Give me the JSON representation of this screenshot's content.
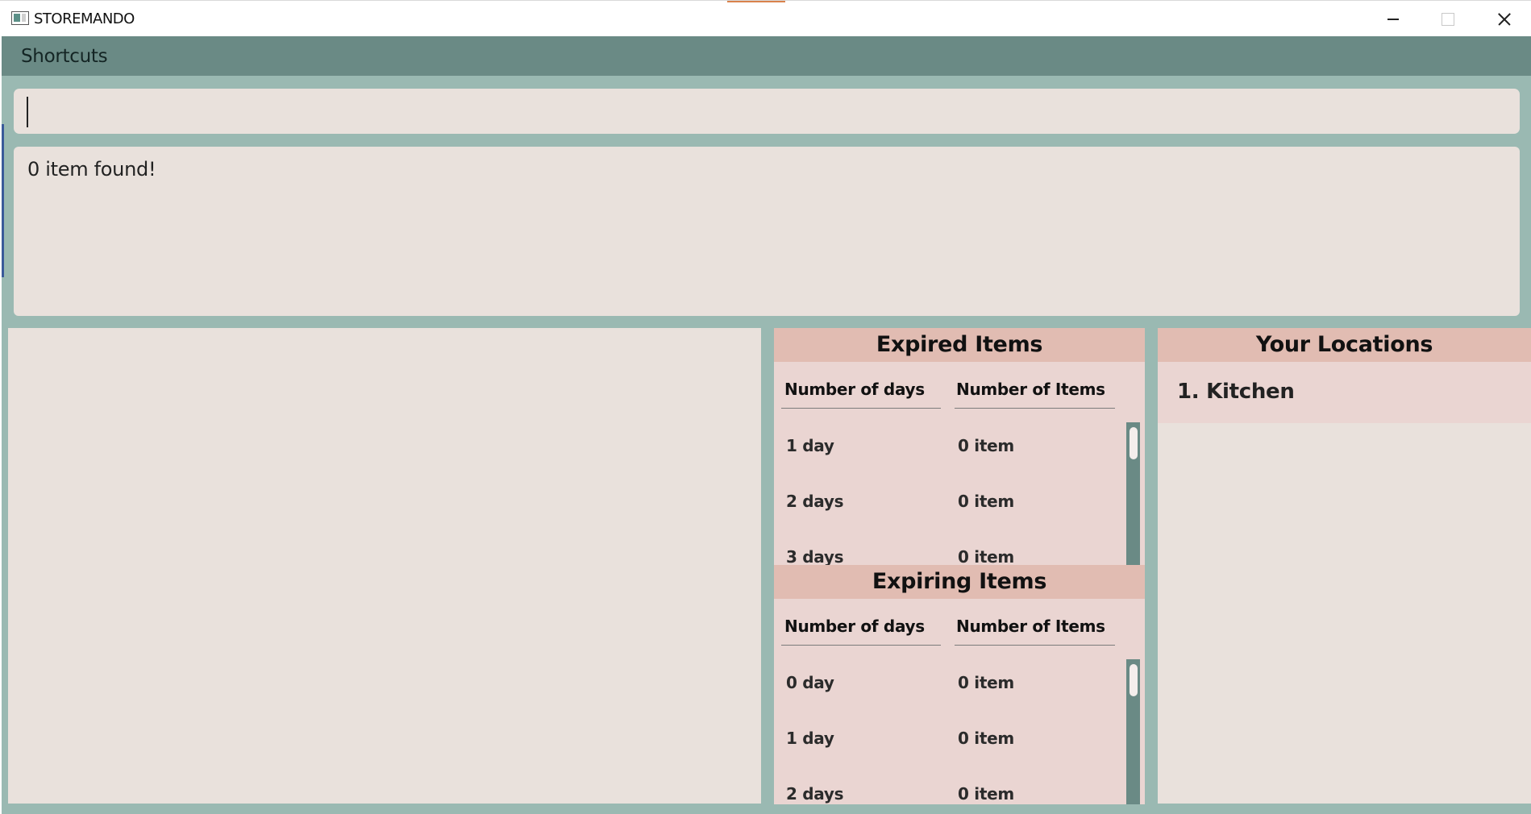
{
  "window": {
    "title": "STOREMANDO"
  },
  "menu": {
    "items": [
      "Shortcuts"
    ]
  },
  "command": {
    "value": "",
    "placeholder": ""
  },
  "result": {
    "message": "0 item found!"
  },
  "expired": {
    "title": "Expired Items",
    "col_days": "Number of days",
    "col_items": "Number of Items",
    "rows": [
      {
        "days": "1 day",
        "items": "0 item"
      },
      {
        "days": "2 days",
        "items": "0 item"
      },
      {
        "days": "3 days",
        "items": "0 item"
      }
    ]
  },
  "expiring": {
    "title": "Expiring Items",
    "col_days": "Number of days",
    "col_items": "Number of Items",
    "rows": [
      {
        "days": "0 day",
        "items": "0 item"
      },
      {
        "days": "1 day",
        "items": "0 item"
      },
      {
        "days": "2 days",
        "items": "0 item"
      }
    ]
  },
  "locations": {
    "title": "Your Locations",
    "items": [
      "1. Kitchen"
    ]
  },
  "colors": {
    "menubar": "#6a8a85",
    "background": "#9ab9b2",
    "panel": "#e9e1dc",
    "stats_bg": "#ead5d2",
    "stats_header": "#e1bcb2"
  },
  "icons": {
    "app": "app-window-icon",
    "minimize": "minimize-icon",
    "maximize": "maximize-icon",
    "close": "close-icon"
  }
}
